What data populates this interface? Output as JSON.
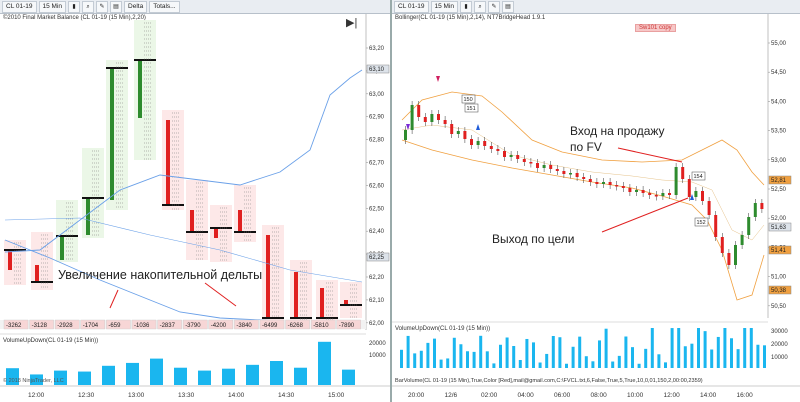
{
  "left": {
    "toolbar": {
      "instrument": "CL 01-19",
      "interval": "15 Min",
      "mode": "Delta",
      "totals": "Totals..."
    },
    "chart_title": "©2010 Final Market Balance  (CL 01-19 (15 Min),2,20)",
    "price_axis": [
      "63,20",
      "63,10",
      "63,00",
      "62,90",
      "62,80",
      "62,70",
      "62,60",
      "62,50",
      "62,40",
      "62,30",
      "62,20",
      "62,10",
      "62,00"
    ],
    "price_tags": {
      "top": "63,10",
      "mid": "62,25"
    },
    "delta_values": [
      "-3262",
      "-3128",
      "-2928",
      "-1704",
      "-659",
      "-1036",
      "-2837",
      "-3790",
      "-4200",
      "-3840",
      "-6499",
      "-6268",
      "-5810",
      "-7890"
    ],
    "annotation": "Увеличение накопительной дельты",
    "volume_title": "VolumeUpDown(CL 01-19 (15 Min))",
    "volume_axis": [
      "20000",
      "10000"
    ],
    "copyright": "© 2018 NinjaTrader, LLC",
    "time_axis": [
      "12:00",
      "12:30",
      "13:00",
      "13:30",
      "14:00",
      "14:30",
      "15:00"
    ]
  },
  "right": {
    "toolbar": {
      "instrument": "CL 01-19",
      "interval": "15 Min"
    },
    "chart_title": "Bollinger(CL 01-19 (15 Min),2,14), NT7BridgeHead 1.9.1",
    "copy_button": "Sw101 copy",
    "price_axis": [
      "55,00",
      "54,50",
      "54,00",
      "53,50",
      "53,00",
      "52,50",
      "52,00",
      "51,50",
      "51,00",
      "50,50"
    ],
    "price_tags": {
      "a": "52,81",
      "b": "51,63",
      "c": "51,41",
      "d": "50,38"
    },
    "annotation_entry_line1": "Вход на продажу",
    "annotation_entry_line2": "по FV",
    "annotation_exit": "Выход по цели",
    "level_labels": [
      "150",
      "151",
      "154",
      "152"
    ],
    "volume_title": "VolumeUpDown(CL 01-19 (15 Min))",
    "volume_axis": [
      "30000",
      "20000",
      "10000"
    ],
    "status_text": "BarVolume(CL 01-19 (15 Min),True,Color [Red],mail@gmail.com,C:\\FVCL.txt,6,False,True,5,True,10,0,01,150,2,00:00,2359)",
    "time_axis": [
      "20:00",
      "12/6",
      "02:00",
      "04:00",
      "06:00",
      "08:00",
      "10:00",
      "12:00",
      "14:00",
      "16:00"
    ]
  },
  "colors": {
    "up": "#2e8b2e",
    "down": "#e02020",
    "volume": "#1ab6ef",
    "band": "#f0a040",
    "ma": "#6aa0e8"
  }
}
